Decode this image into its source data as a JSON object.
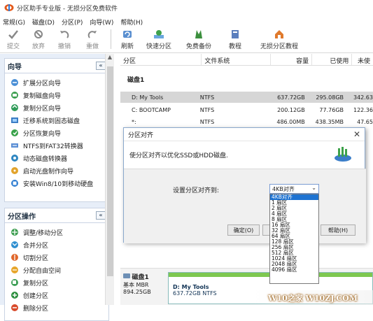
{
  "window": {
    "title": "分区助手专业版 - 无损分区免费软件"
  },
  "menu": [
    "常规(G)",
    "磁盘(D)",
    "分区(P)",
    "向导(W)",
    "帮助(H)"
  ],
  "toolbar": {
    "submit": "提交",
    "discard": "放弃",
    "undo": "撤销",
    "redo": "重做",
    "refresh": "刷新",
    "quick_partition": "快速分区",
    "free_backup": "免费备份",
    "tutorial": "教程",
    "lossless_tutorial": "无损分区教程"
  },
  "wizard_panel": {
    "title": "向导",
    "collapse": "«",
    "items": [
      {
        "label": "扩展分区向导",
        "icon": "extend-partition-icon"
      },
      {
        "label": "复制磁盘向导",
        "icon": "copy-disk-icon"
      },
      {
        "label": "复制分区向导",
        "icon": "copy-partition-icon"
      },
      {
        "label": "迁移系统到固态磁盘",
        "icon": "migrate-os-icon"
      },
      {
        "label": "分区恢复向导",
        "icon": "recover-partition-icon"
      },
      {
        "label": "NTFS到FAT32转换器",
        "icon": "ntfs-fat32-icon"
      },
      {
        "label": "动态磁盘转换器",
        "icon": "dynamic-disk-icon"
      },
      {
        "label": "启动光盘制作向导",
        "icon": "bootable-cd-icon"
      },
      {
        "label": "安装Win8/10到移动硬盘",
        "icon": "windows-to-go-icon"
      }
    ]
  },
  "partition_panel": {
    "title": "分区操作",
    "collapse": "«",
    "items": [
      {
        "label": "调整/移动分区",
        "icon": "resize-move-icon"
      },
      {
        "label": "合并分区",
        "icon": "merge-icon"
      },
      {
        "label": "切割分区",
        "icon": "split-icon"
      },
      {
        "label": "分配自由空间",
        "icon": "allocate-space-icon"
      },
      {
        "label": "复制分区",
        "icon": "copy-icon"
      },
      {
        "label": "创建分区",
        "icon": "create-icon"
      },
      {
        "label": "删除分区",
        "icon": "delete-icon"
      }
    ]
  },
  "table": {
    "headers": [
      "分区",
      "文件系统",
      "容量",
      "已使用",
      "未使"
    ],
    "disk_label": "磁盘1",
    "rows": [
      {
        "name": "D: My Tools",
        "fs": "NTFS",
        "cap": "637.72GB",
        "used": "295.08GB",
        "free": "342.63"
      },
      {
        "name": "C: BOOTCAMP",
        "fs": "NTFS",
        "cap": "200.12GB",
        "used": "77.76GB",
        "free": "122.36"
      },
      {
        "name": "*:",
        "fs": "NTFS",
        "cap": "486.00MB",
        "used": "438.35MB",
        "free": "47.65"
      }
    ]
  },
  "disk_map": {
    "disk_name": "磁盘1",
    "disk_type": "基本 MBR",
    "disk_size": "894.25GB",
    "part_name": "D: My Tools",
    "part_detail": "637.72GB NTFS"
  },
  "dialog": {
    "title": "分区对齐",
    "close": "✕",
    "description": "使分区对齐以优化SSD或HDD磁盘.",
    "field_label": "设置分区对齐到:",
    "selected": "4KB对齐",
    "ok": "确定(O)",
    "cancel": "取消",
    "help": "帮助(H)",
    "options": [
      "4KB对齐",
      "1 扇区",
      "2 扇区",
      "4 扇区",
      "8 扇区",
      "16 扇区",
      "32 扇区",
      "64 扇区",
      "128 扇区",
      "256 扇区",
      "512 扇区",
      "1024 扇区",
      "2048 扇区",
      "4096 扇区"
    ]
  },
  "watermark": "W10之家 W10ZJ.COM",
  "colors": {
    "accent": "#1e73d2",
    "sidebar": "#e7eef8",
    "selected_row": "#d6d6d6",
    "partition_bar": "#7ec850"
  }
}
